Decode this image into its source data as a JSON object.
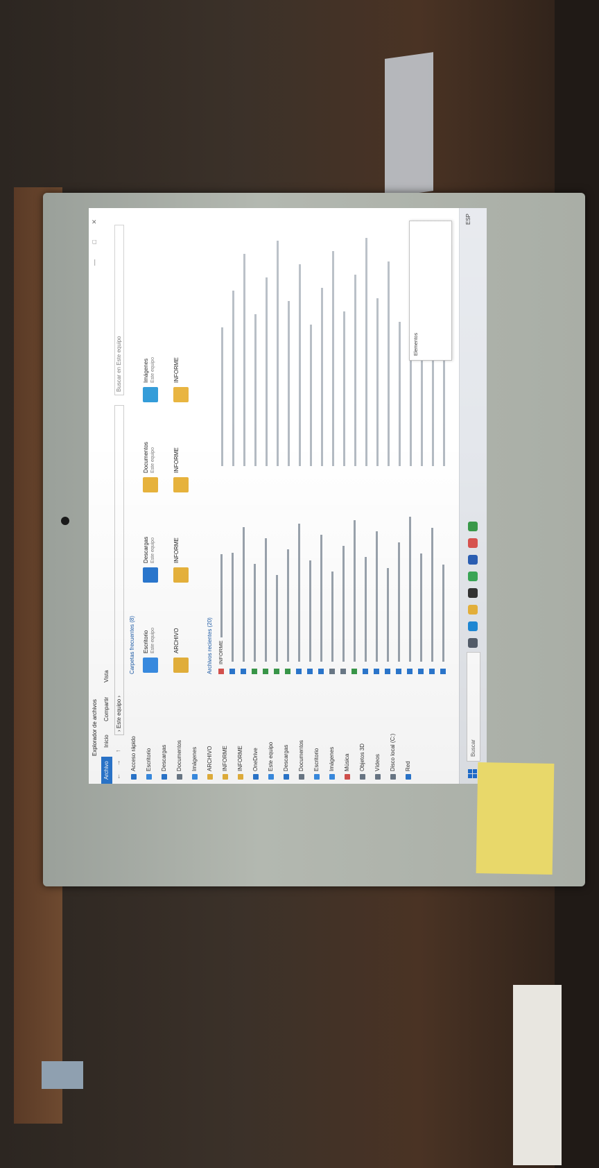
{
  "window": {
    "title": "Explorador de archivos",
    "controls": "—  □  ✕"
  },
  "ribbon": {
    "tabs": [
      "Archivo",
      "Inicio",
      "Compartir",
      "Vista"
    ]
  },
  "addressbar": {
    "nav": "← → ↑",
    "path": "› Este equipo ›",
    "search_placeholder": "Buscar en Este equipo"
  },
  "sidebar": {
    "items": [
      {
        "label": "Acceso rápido",
        "color": "#2b78d0"
      },
      {
        "label": "Escritorio",
        "color": "#3a8ee6"
      },
      {
        "label": "Descargas",
        "color": "#2b78d0"
      },
      {
        "label": "Documentos",
        "color": "#6c7a89"
      },
      {
        "label": "Imágenes",
        "color": "#3a8ee6"
      },
      {
        "label": "ARCHIVO",
        "color": "#e8b33c"
      },
      {
        "label": "INFORME",
        "color": "#e8b33c"
      },
      {
        "label": "INFORME",
        "color": "#e8b33c"
      },
      {
        "label": "OneDrive",
        "color": "#2b78d0"
      },
      {
        "label": "Este equipo",
        "color": "#3a8ee6"
      },
      {
        "label": "Descargas",
        "color": "#2b78d0"
      },
      {
        "label": "Documentos",
        "color": "#6c7a89"
      },
      {
        "label": "Escritorio",
        "color": "#3a8ee6"
      },
      {
        "label": "Imágenes",
        "color": "#3a8ee6"
      },
      {
        "label": "Música",
        "color": "#d9534f"
      },
      {
        "label": "Objetos 3D",
        "color": "#6c7a89"
      },
      {
        "label": "Vídeos",
        "color": "#6c7a89"
      },
      {
        "label": "Disco local (C:)",
        "color": "#6c7a89"
      },
      {
        "label": "Red",
        "color": "#2b78d0"
      }
    ]
  },
  "main": {
    "section_quick": "Carpetas frecuentes (8)",
    "tiles": [
      {
        "name": "Escritorio",
        "sub": "Este equipo",
        "color": "#3a8ee6"
      },
      {
        "name": "Descargas",
        "sub": "Este equipo",
        "color": "#2b78d0"
      },
      {
        "name": "Documentos",
        "sub": "Este equipo",
        "color": "#e8b33c"
      },
      {
        "name": "Imágenes",
        "sub": "Este equipo",
        "color": "#2f9ad8"
      },
      {
        "name": "ARCHIVO",
        "sub": "",
        "color": "#e8b33c"
      },
      {
        "name": "INFORME",
        "sub": "",
        "color": "#e8b33c"
      },
      {
        "name": "INFORME",
        "sub": "",
        "color": "#e8b33c"
      },
      {
        "name": "INFORME",
        "sub": "",
        "color": "#e8b33c"
      }
    ],
    "section_recent": "Archivos recientes (20)",
    "files": [
      {
        "icon": "#d9534f",
        "name": "INFORME",
        "date": "",
        "desc": ""
      },
      {
        "icon": "#2b78d0",
        "name": "",
        "date": "",
        "desc": ""
      },
      {
        "icon": "#2b78d0",
        "name": "",
        "date": "",
        "desc": ""
      },
      {
        "icon": "#3a9a4a",
        "name": "",
        "date": "",
        "desc": ""
      },
      {
        "icon": "#3a9a4a",
        "name": "",
        "date": "",
        "desc": ""
      },
      {
        "icon": "#3a9a4a",
        "name": "",
        "date": "",
        "desc": ""
      },
      {
        "icon": "#3a9a4a",
        "name": "",
        "date": "",
        "desc": ""
      },
      {
        "icon": "#2b78d0",
        "name": "",
        "date": "",
        "desc": ""
      },
      {
        "icon": "#2b78d0",
        "name": "",
        "date": "",
        "desc": ""
      },
      {
        "icon": "#2b78d0",
        "name": "",
        "date": "",
        "desc": ""
      },
      {
        "icon": "#6c7a89",
        "name": "",
        "date": "",
        "desc": ""
      },
      {
        "icon": "#6c7a89",
        "name": "",
        "date": "",
        "desc": ""
      },
      {
        "icon": "#3a9a4a",
        "name": "",
        "date": "",
        "desc": ""
      },
      {
        "icon": "#2b78d0",
        "name": "",
        "date": "",
        "desc": ""
      },
      {
        "icon": "#2b78d0",
        "name": "",
        "date": "",
        "desc": ""
      },
      {
        "icon": "#2b78d0",
        "name": "",
        "date": "",
        "desc": ""
      },
      {
        "icon": "#2b78d0",
        "name": "",
        "date": "",
        "desc": ""
      },
      {
        "icon": "#2b78d0",
        "name": "",
        "date": "",
        "desc": ""
      },
      {
        "icon": "#2b78d0",
        "name": "",
        "date": "",
        "desc": ""
      },
      {
        "icon": "#2b78d0",
        "name": "",
        "date": "",
        "desc": ""
      },
      {
        "icon": "#2b78d0",
        "name": "",
        "date": "",
        "desc": ""
      }
    ]
  },
  "status": {
    "items": "Elementos"
  },
  "taskbar": {
    "search": "Buscar",
    "icons": [
      {
        "name": "task-view-icon",
        "color": "#555e6b"
      },
      {
        "name": "edge-icon",
        "color": "#1f8ad8"
      },
      {
        "name": "file-explorer-icon",
        "color": "#e8b33c"
      },
      {
        "name": "store-icon",
        "color": "#333333"
      },
      {
        "name": "chrome-icon",
        "color": "#3aa757"
      },
      {
        "name": "word-icon",
        "color": "#2b5fb4"
      },
      {
        "name": "acrobat-icon",
        "color": "#d9534f"
      },
      {
        "name": "excel-icon",
        "color": "#3a9a4a"
      }
    ],
    "tray": "ESP",
    "time": "",
    "date": ""
  },
  "sticky_note": {
    "text": ""
  }
}
